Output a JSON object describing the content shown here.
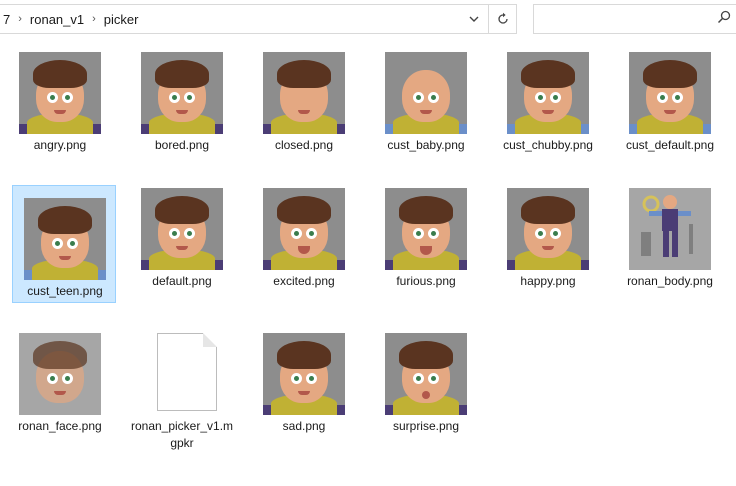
{
  "breadcrumb": {
    "partial": "7",
    "folder1": "ronan_v1",
    "folder2": "picker"
  },
  "search": {
    "placeholder": ""
  },
  "icons": {
    "chevron": "chevron-right-icon",
    "dropdown": "chevron-down-icon",
    "refresh": "refresh-icon",
    "search": "search-icon"
  },
  "files": [
    {
      "name": "angry.png"
    },
    {
      "name": "bored.png"
    },
    {
      "name": "closed.png"
    },
    {
      "name": "cust_baby.png"
    },
    {
      "name": "cust_chubby.png"
    },
    {
      "name": "cust_default.png"
    },
    {
      "name": "cust_teen.png"
    },
    {
      "name": "default.png"
    },
    {
      "name": "excited.png"
    },
    {
      "name": "furious.png"
    },
    {
      "name": "happy.png"
    },
    {
      "name": "ronan_body.png"
    },
    {
      "name": "ronan_face.png"
    },
    {
      "name": "ronan_picker_v1.mgpkr"
    },
    {
      "name": "sad.png"
    },
    {
      "name": "surprise.png"
    }
  ]
}
